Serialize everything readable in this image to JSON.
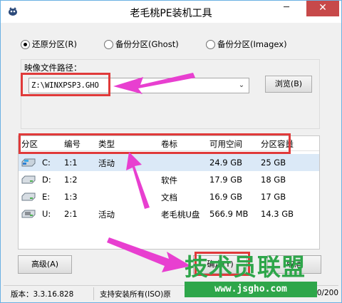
{
  "window": {
    "title": "老毛桃PE装机工具",
    "minimize_glyph": "─",
    "maximize_glyph": "□",
    "close_glyph": "✕"
  },
  "modes": [
    {
      "label": "还原分区(R)",
      "checked": true
    },
    {
      "label": "备份分区(Ghost)",
      "checked": false
    },
    {
      "label": "备份分区(Imagex)",
      "checked": false
    }
  ],
  "image_path": {
    "label": "映像文件路径：",
    "value": "Z:\\WINXPSP3.GHO",
    "browse_label": "浏览(B)"
  },
  "partition_table": {
    "columns": [
      "分区",
      "编号",
      "类型",
      "卷标",
      "可用空间",
      "分区容量"
    ],
    "rows": [
      {
        "drive": "C:",
        "number": "1:1",
        "type": "活动",
        "label": "",
        "free": "24.9 GB",
        "capacity": "25 GB",
        "selected": true,
        "icon": "hard-drive-windows-icon"
      },
      {
        "drive": "D:",
        "number": "1:2",
        "type": "",
        "label": "软件",
        "free": "17.9 GB",
        "capacity": "18 GB",
        "selected": false,
        "icon": "hard-drive-icon"
      },
      {
        "drive": "E:",
        "number": "1:3",
        "type": "",
        "label": "文档",
        "free": "16.9 GB",
        "capacity": "17 GB",
        "selected": false,
        "icon": "hard-drive-icon"
      },
      {
        "drive": "U:",
        "number": "2:1",
        "type": "活动",
        "label": "老毛桃U盘",
        "free": "566.9 MB",
        "capacity": "14.3 GB",
        "selected": false,
        "icon": "usb-drive-icon"
      }
    ]
  },
  "buttons": {
    "advanced": "高级(A)",
    "ok": "确定(Y)",
    "cancel": "取消"
  },
  "status": {
    "version": "版本：3.3.16.828",
    "support": "支持安装所有(ISO)原",
    "tail": "0/200"
  },
  "watermark": {
    "brand": "技术员联盟",
    "url": "www.jsgho.com"
  },
  "colors": {
    "highlight": "#e03a3a",
    "arrow": "#e83fd0",
    "watermark": "#2ea64a",
    "close": "#c7494a"
  }
}
